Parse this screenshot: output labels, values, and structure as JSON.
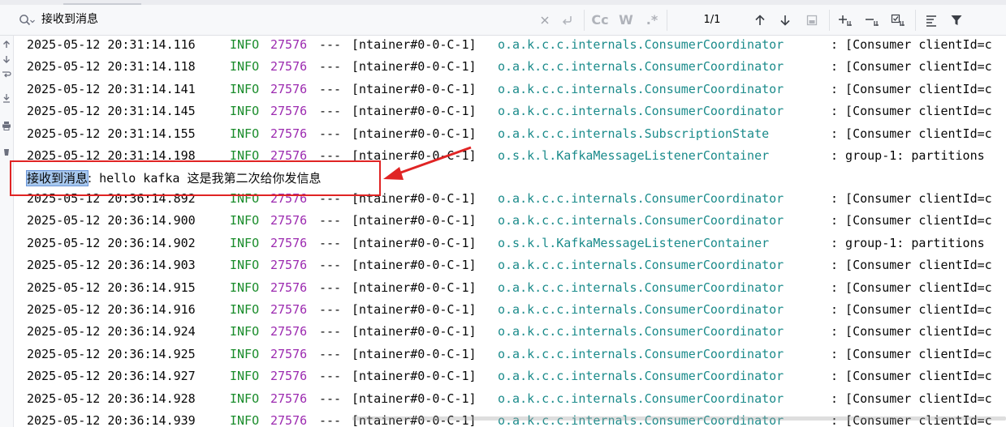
{
  "search": {
    "query": "接收到消息",
    "match_count": "1/1",
    "case_label": "Cc",
    "word_label": "W",
    "regex_label": ".*"
  },
  "colors": {
    "info": "#1a8c2b",
    "pid": "#9c2ab0",
    "class": "#1b8b8b",
    "highlight": "#a6c7ee",
    "annotation": "#e02424"
  },
  "log_rows_before": [
    {
      "ts": "2025-05-12 20:31:14.116",
      "level": "INFO",
      "pid": "27576",
      "sep": "---",
      "thread": "[ntainer#0-0-C-1]",
      "logger": "o.a.k.c.c.internals.ConsumerCoordinator",
      "msg": ": [Consumer clientId=c"
    },
    {
      "ts": "2025-05-12 20:31:14.118",
      "level": "INFO",
      "pid": "27576",
      "sep": "---",
      "thread": "[ntainer#0-0-C-1]",
      "logger": "o.a.k.c.c.internals.ConsumerCoordinator",
      "msg": ": [Consumer clientId=c"
    },
    {
      "ts": "2025-05-12 20:31:14.141",
      "level": "INFO",
      "pid": "27576",
      "sep": "---",
      "thread": "[ntainer#0-0-C-1]",
      "logger": "o.a.k.c.c.internals.ConsumerCoordinator",
      "msg": ": [Consumer clientId=c"
    },
    {
      "ts": "2025-05-12 20:31:14.145",
      "level": "INFO",
      "pid": "27576",
      "sep": "---",
      "thread": "[ntainer#0-0-C-1]",
      "logger": "o.a.k.c.c.internals.ConsumerCoordinator",
      "msg": ": [Consumer clientId=c"
    },
    {
      "ts": "2025-05-12 20:31:14.155",
      "level": "INFO",
      "pid": "27576",
      "sep": "---",
      "thread": "[ntainer#0-0-C-1]",
      "logger": "o.a.k.c.c.internals.SubscriptionState",
      "msg": ": [Consumer clientId=c"
    },
    {
      "ts": "2025-05-12 20:31:14.198",
      "level": "INFO",
      "pid": "27576",
      "sep": "---",
      "thread": "[ntainer#0-0-C-1]",
      "logger": "o.s.k.l.KafkaMessageListenerContainer",
      "msg": ": group-1: partitions"
    }
  ],
  "message_row": {
    "highlighted": "接收到消息",
    "colon": ":",
    "latin": " hello kafka ",
    "cjk": "这是我第二次给你发信息"
  },
  "log_rows_after": [
    {
      "ts": "2025-05-12 20:36:14.892",
      "level": "INFO",
      "pid": "27576",
      "sep": "---",
      "thread": "[ntainer#0-0-C-1]",
      "logger": "o.a.k.c.c.internals.ConsumerCoordinator",
      "msg": ": [Consumer clientId=c"
    },
    {
      "ts": "2025-05-12 20:36:14.900",
      "level": "INFO",
      "pid": "27576",
      "sep": "---",
      "thread": "[ntainer#0-0-C-1]",
      "logger": "o.a.k.c.c.internals.ConsumerCoordinator",
      "msg": ": [Consumer clientId=c"
    },
    {
      "ts": "2025-05-12 20:36:14.902",
      "level": "INFO",
      "pid": "27576",
      "sep": "---",
      "thread": "[ntainer#0-0-C-1]",
      "logger": "o.s.k.l.KafkaMessageListenerContainer",
      "msg": ": group-1: partitions"
    },
    {
      "ts": "2025-05-12 20:36:14.903",
      "level": "INFO",
      "pid": "27576",
      "sep": "---",
      "thread": "[ntainer#0-0-C-1]",
      "logger": "o.a.k.c.c.internals.ConsumerCoordinator",
      "msg": ": [Consumer clientId=c"
    },
    {
      "ts": "2025-05-12 20:36:14.915",
      "level": "INFO",
      "pid": "27576",
      "sep": "---",
      "thread": "[ntainer#0-0-C-1]",
      "logger": "o.a.k.c.c.internals.ConsumerCoordinator",
      "msg": ": [Consumer clientId=c"
    },
    {
      "ts": "2025-05-12 20:36:14.916",
      "level": "INFO",
      "pid": "27576",
      "sep": "---",
      "thread": "[ntainer#0-0-C-1]",
      "logger": "o.a.k.c.c.internals.ConsumerCoordinator",
      "msg": ": [Consumer clientId=c"
    },
    {
      "ts": "2025-05-12 20:36:14.924",
      "level": "INFO",
      "pid": "27576",
      "sep": "---",
      "thread": "[ntainer#0-0-C-1]",
      "logger": "o.a.k.c.c.internals.ConsumerCoordinator",
      "msg": ": [Consumer clientId=c"
    },
    {
      "ts": "2025-05-12 20:36:14.925",
      "level": "INFO",
      "pid": "27576",
      "sep": "---",
      "thread": "[ntainer#0-0-C-1]",
      "logger": "o.a.k.c.c.internals.ConsumerCoordinator",
      "msg": ": [Consumer clientId=c"
    },
    {
      "ts": "2025-05-12 20:36:14.927",
      "level": "INFO",
      "pid": "27576",
      "sep": "---",
      "thread": "[ntainer#0-0-C-1]",
      "logger": "o.a.k.c.c.internals.ConsumerCoordinator",
      "msg": ": [Consumer clientId=c"
    },
    {
      "ts": "2025-05-12 20:36:14.928",
      "level": "INFO",
      "pid": "27576",
      "sep": "---",
      "thread": "[ntainer#0-0-C-1]",
      "logger": "o.a.k.c.c.internals.ConsumerCoordinator",
      "msg": ": [Consumer clientId=c"
    },
    {
      "ts": "2025-05-12 20:36:14.939",
      "level": "INFO",
      "pid": "27576",
      "sep": "---",
      "thread": "[ntainer#0-0-C-1]",
      "logger": "o.a.k.c.c.internals.ConsumerCoordinator",
      "msg": ": [Consumer clientId=c"
    }
  ]
}
